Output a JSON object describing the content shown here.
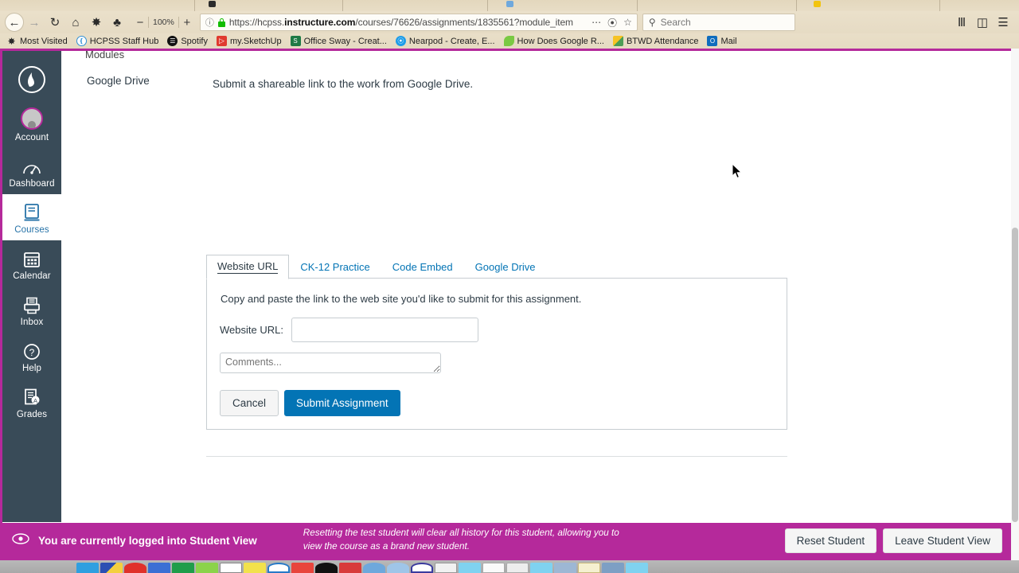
{
  "browser": {
    "nav": {
      "back_icon": "back-arrow-icon",
      "forward_icon": "forward-arrow-icon",
      "reload_icon": "reload-icon",
      "home_icon": "home-icon",
      "settings_icon": "gear-icon",
      "extension_icon": "puzzle-piece-icon",
      "zoom_out_label": "−",
      "zoom_level": "100%",
      "zoom_in_label": "+"
    },
    "url": {
      "identity_icon": "info-circle-icon",
      "lock_icon": "lock-icon",
      "scheme": "https://hcpss.",
      "domain": "instructure.com",
      "path": "/courses/76626/assignments/1835561?module_item",
      "full": "https://hcpss.instructure.com/courses/76626/assignments/1835561?module_item",
      "more_icon": "ellipsis-icon",
      "pocket_icon": "pocket-icon",
      "bookmark_icon": "star-icon"
    },
    "search": {
      "icon": "search-icon",
      "placeholder": "Search",
      "value": ""
    },
    "right_buttons": {
      "library_icon": "library-icon",
      "sidebar_icon": "sidebar-icon",
      "menu_icon": "hamburger-menu-icon"
    },
    "bookmarks": [
      {
        "label": "Most Visited",
        "icon": "most-visited-icon",
        "color": "#2b2b2b"
      },
      {
        "label": "HCPSS Staff Hub",
        "icon": "hcpss-icon",
        "color": "#2f8fd4"
      },
      {
        "label": "Spotify",
        "icon": "spotify-icon",
        "color": "#111111"
      },
      {
        "label": "my.SketchUp",
        "icon": "sketchup-icon",
        "color": "#e03a2f"
      },
      {
        "label": "Office Sway - Creat...",
        "icon": "office-sway-icon",
        "color": "#1f7a45"
      },
      {
        "label": "Nearpod - Create, E...",
        "icon": "nearpod-icon",
        "color": "#1e9ce8"
      },
      {
        "label": "How Does Google R...",
        "icon": "leaf-icon",
        "color": "#7ac943"
      },
      {
        "label": "BTWD Attendance",
        "icon": "google-drive-icon",
        "color": "#f6c324"
      },
      {
        "label": "Mail",
        "icon": "outlook-mail-icon",
        "color": "#0f6cbd"
      }
    ]
  },
  "sidebar": {
    "brand_icon": "canvas-logo-icon",
    "items": [
      {
        "label": "Account",
        "icon": "user-avatar-icon",
        "active": false
      },
      {
        "label": "Dashboard",
        "icon": "dashboard-icon",
        "active": false
      },
      {
        "label": "Courses",
        "icon": "courses-book-icon",
        "active": true
      },
      {
        "label": "Calendar",
        "icon": "calendar-icon",
        "active": false
      },
      {
        "label": "Inbox",
        "icon": "inbox-icon",
        "active": false
      },
      {
        "label": "Help",
        "icon": "help-question-icon",
        "active": false
      },
      {
        "label": "Grades",
        "icon": "grades-icon",
        "active": false
      }
    ]
  },
  "main": {
    "breadcrumb": "Modules",
    "detail_label": "Google Drive",
    "detail_text": "Submit a shareable link to the work from Google Drive.",
    "submission": {
      "tabs": [
        {
          "label": "Website URL",
          "active": true
        },
        {
          "label": "CK-12 Practice",
          "active": false
        },
        {
          "label": "Code Embed",
          "active": false
        },
        {
          "label": "Google Drive",
          "active": false
        }
      ],
      "hint": "Copy and paste the link to the web site you'd like to submit for this assignment.",
      "url_label": "Website URL:",
      "url_value": "",
      "url_placeholder": "",
      "comments_value": "",
      "comments_placeholder": "Comments...",
      "cancel_label": "Cancel",
      "submit_label": "Submit Assignment",
      "accent_color": "#0374B5"
    }
  },
  "student_view_bar": {
    "icon": "eye-icon",
    "message": "You are currently logged into Student View",
    "note": "Resetting the test student will clear all history for this student, allowing you to view the course as a brand new student.",
    "reset_label": "Reset Student",
    "leave_label": "Leave Student View",
    "color": "#b5299b"
  }
}
